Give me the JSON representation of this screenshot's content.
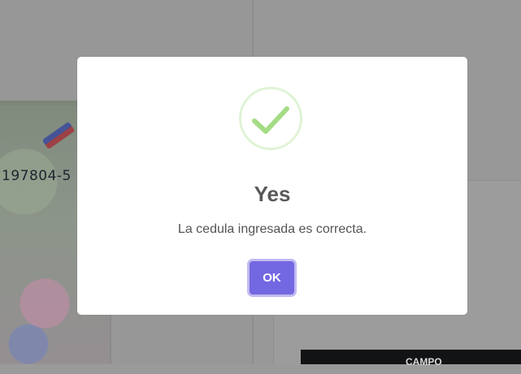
{
  "background": {
    "id_card_number": "197804-5",
    "table_header_label": "CAMPO"
  },
  "dialog": {
    "icon": "success-check-icon",
    "title": "Yes",
    "message": "La cedula ingresada es correcta.",
    "ok_label": "OK",
    "colors": {
      "accent": "#7367e2",
      "success": "#a5dc86",
      "title": "#595959",
      "text": "#545454"
    }
  }
}
